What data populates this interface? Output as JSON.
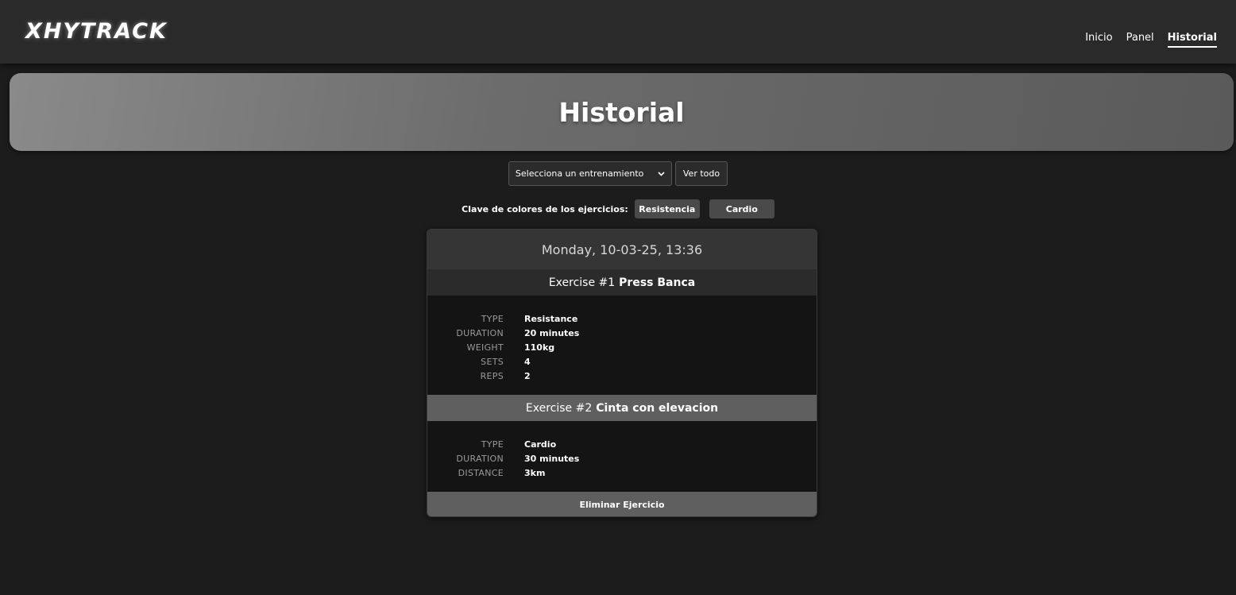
{
  "header": {
    "logo": "XHYTRACK",
    "nav": [
      {
        "label": "Inicio"
      },
      {
        "label": "Panel"
      },
      {
        "label": "Historial"
      }
    ]
  },
  "hero": {
    "title": "Historial"
  },
  "controls": {
    "select_value": "Selecciona un entrenamiento",
    "view_all_label": "Ver todo"
  },
  "color_key": {
    "label": "Clave de colores de los ejercicios:",
    "resistance": "Resistencia",
    "cardio": "Cardio"
  },
  "workout": {
    "date": "Monday, 10-03-25, 13:36",
    "exercises": [
      {
        "prefix": "Exercise #1",
        "name": "Press Banca",
        "fields": [
          {
            "key": "TYPE",
            "value": "Resistance"
          },
          {
            "key": "DURATION",
            "value": "20 minutes"
          },
          {
            "key": "WEIGHT",
            "value": "110kg"
          },
          {
            "key": "SETS",
            "value": "4"
          },
          {
            "key": "REPS",
            "value": "2"
          }
        ]
      },
      {
        "prefix": "Exercise #2",
        "name": "Cinta con elevacion",
        "fields": [
          {
            "key": "TYPE",
            "value": "Cardio"
          },
          {
            "key": "DURATION",
            "value": "30 minutes"
          },
          {
            "key": "DISTANCE",
            "value": "3km"
          }
        ]
      }
    ],
    "delete_label": "Eliminar Ejercicio"
  }
}
